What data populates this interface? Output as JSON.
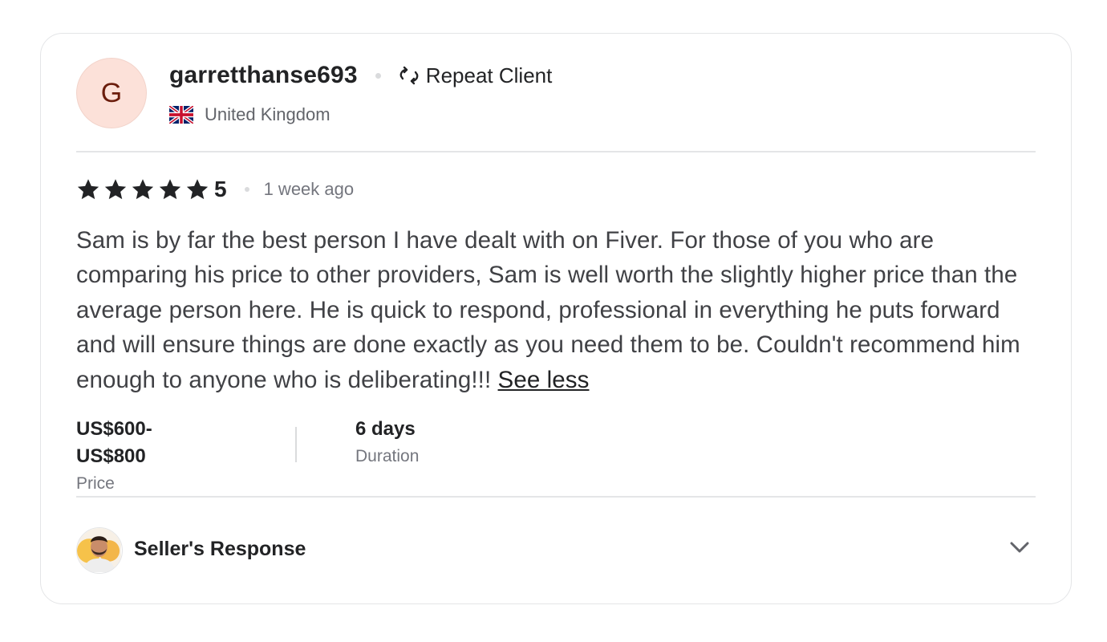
{
  "reviewer": {
    "avatar_initial": "G",
    "username": "garretthanse693",
    "badge_label": "Repeat Client",
    "country": "United Kingdom",
    "flag_icon": "uk-flag-icon"
  },
  "rating": {
    "stars": 5,
    "value": "5",
    "time_ago": "1 week ago"
  },
  "review": {
    "text": "Sam is by far the best person I have dealt with on Fiver. For those of you who are comparing his price to other providers, Sam is well worth the slightly higher price than the average person here. He is quick to respond, professional in everything he puts forward and will ensure things are done exactly as you need them to be. Couldn't recommend him enough to anyone who is deliberating!!!",
    "toggle_label": "See less"
  },
  "stats": {
    "price": {
      "value": "US$600-US$800",
      "label": "Price"
    },
    "duration": {
      "value": "6 days",
      "label": "Duration"
    }
  },
  "seller_response": {
    "label": "Seller's Response",
    "expand_icon": "chevron-down-icon"
  },
  "colors": {
    "avatar_bg": "#fce1d9",
    "avatar_text": "#6b1d0c",
    "text_dark": "#222325",
    "text_body": "#404145",
    "text_muted": "#74767e",
    "border": "#e4e5e7"
  }
}
